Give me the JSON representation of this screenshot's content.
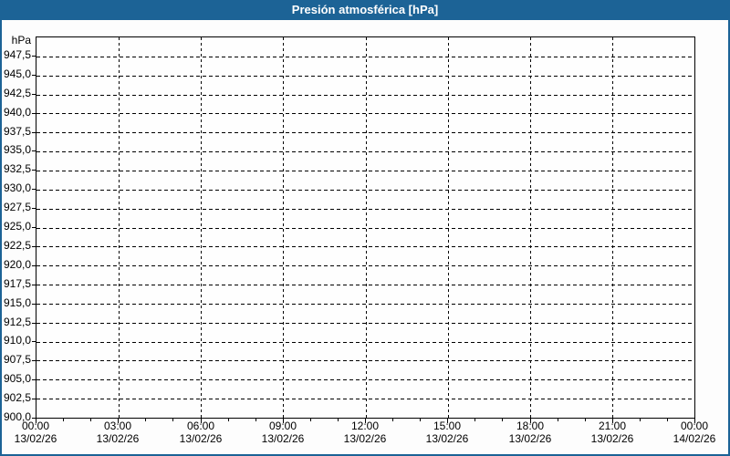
{
  "window": {
    "title": "Presión atmosférica [hPa]"
  },
  "colors": {
    "titlebar_bg": "#1c6396",
    "titlebar_text": "#ffffff",
    "frame_border": "#1c6396",
    "background": "#fdfdfd",
    "plot_background": "#fefefe",
    "grid": "#000000",
    "axis": "#000000",
    "label_text": "#000000"
  },
  "y_axis": {
    "unit": "hPa",
    "tick_labels": [
      "947,5",
      "945,0",
      "942,5",
      "940,0",
      "937,5",
      "935,0",
      "932,5",
      "930,0",
      "927,5",
      "925,0",
      "922,5",
      "920,0",
      "917,5",
      "915,0",
      "912,5",
      "910,0",
      "907,5",
      "905,0",
      "902,5",
      "900,0"
    ]
  },
  "x_axis": {
    "ticks": [
      {
        "time": "00:00",
        "date": "13/02/26"
      },
      {
        "time": "03:00",
        "date": "13/02/26"
      },
      {
        "time": "06:00",
        "date": "13/02/26"
      },
      {
        "time": "09:00",
        "date": "13/02/26"
      },
      {
        "time": "12:00",
        "date": "13/02/26"
      },
      {
        "time": "15:00",
        "date": "13/02/26"
      },
      {
        "time": "18:00",
        "date": "13/02/26"
      },
      {
        "time": "21:00",
        "date": "13/02/26"
      },
      {
        "time": "00:00",
        "date": "14/02/26"
      }
    ]
  },
  "chart_data": {
    "type": "line",
    "title": "Presión atmosférica [hPa]",
    "ylabel": "hPa",
    "ylim": [
      900,
      950
    ],
    "ytick_step": 2.5,
    "xlim": [
      "13/02/26 00:00",
      "14/02/26 00:00"
    ],
    "xtick_step_hours": 3,
    "minor_xtick_step_hours": 1,
    "grid": true,
    "legend": false,
    "series": []
  }
}
